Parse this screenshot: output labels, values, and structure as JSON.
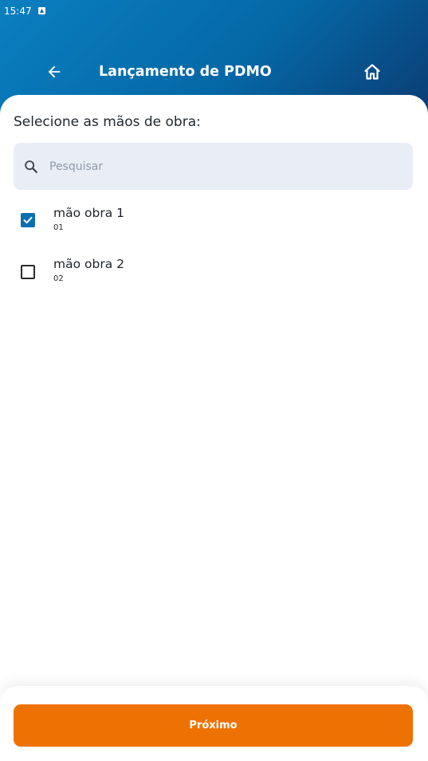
{
  "status_bar": {
    "time": "15:47"
  },
  "header": {
    "title": "Lançamento de PDMO",
    "back_icon": "arrow-left-icon",
    "home_icon": "home-icon"
  },
  "main": {
    "instruction": "Selecione as mãos de obra:",
    "search": {
      "placeholder": "Pesquisar",
      "value": "",
      "icon": "search-icon"
    },
    "items": [
      {
        "name": "mão obra 1",
        "code": "01",
        "checked": true
      },
      {
        "name": "mão obra 2",
        "code": "02",
        "checked": false
      }
    ]
  },
  "footer": {
    "next_label": "Próximo"
  },
  "colors": {
    "header_gradient_start": "#0a7fc0",
    "header_gradient_end": "#0b3c73",
    "accent": "#0c6fb0",
    "button": "#ee7203",
    "search_bg": "#e8edf6"
  }
}
